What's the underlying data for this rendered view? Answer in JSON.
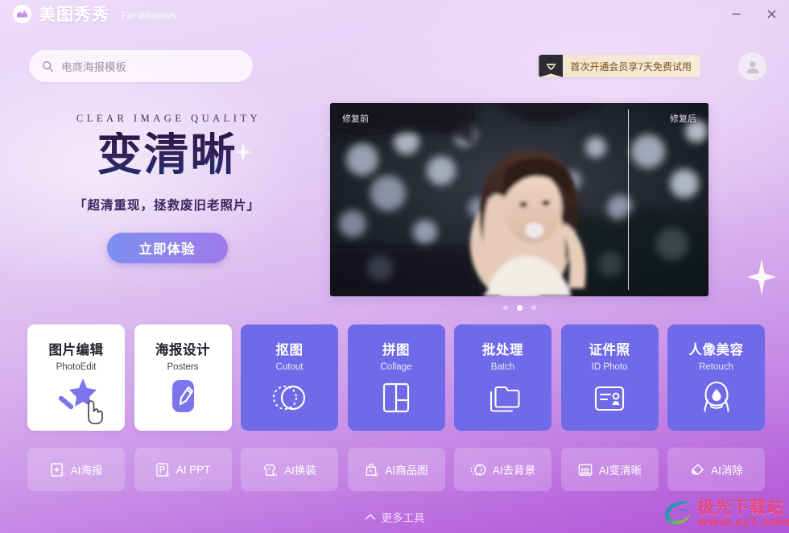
{
  "window": {
    "app_title": "美图秀秀",
    "app_subtitle": "For Windows",
    "minimize_label": "minimize",
    "close_label": "close"
  },
  "search": {
    "placeholder": "电商海报模板",
    "icon": "search-icon"
  },
  "vip": {
    "text": "首次开通会员享7天免费试用",
    "badge_icon": "vip-crown-icon",
    "badge_color": "#2e2a33",
    "banner_color": "#f3e4cc"
  },
  "account": {
    "avatar_icon": "user-avatar-icon"
  },
  "hero": {
    "eyebrow": "CLEAR IMAGE QUALITY",
    "title": "变清晰",
    "subtitle": "「超清重现，拯救废旧老照片」",
    "cta_label": "立即体验",
    "cta_color": "#8e86ee",
    "image": {
      "label_before": "修复前",
      "label_after": "修复后"
    },
    "carousel": {
      "total": 3,
      "active_index": 1
    }
  },
  "tools": [
    {
      "cn": "图片编辑",
      "en": "PhotoEdit",
      "icon": "magic-wand-icon",
      "style": "white"
    },
    {
      "cn": "海报设计",
      "en": "Posters",
      "icon": "pencil-icon",
      "style": "white"
    },
    {
      "cn": "抠图",
      "en": "Cutout",
      "icon": "cutout-circle-icon",
      "style": "purple"
    },
    {
      "cn": "拼图",
      "en": "Collage",
      "icon": "collage-grid-icon",
      "style": "purple"
    },
    {
      "cn": "批处理",
      "en": "Batch",
      "icon": "folders-icon",
      "style": "purple"
    },
    {
      "cn": "证件照",
      "en": "ID Photo",
      "icon": "id-card-icon",
      "style": "purple"
    },
    {
      "cn": "人像美容",
      "en": "Retouch",
      "icon": "portrait-face-icon",
      "style": "purple"
    }
  ],
  "ai_tools": [
    {
      "label": "AI海报",
      "icon": "ai-poster-icon"
    },
    {
      "label": "AI PPT",
      "icon": "ai-ppt-icon"
    },
    {
      "label": "AI换装",
      "icon": "ai-clothes-icon"
    },
    {
      "label": "AI商品图",
      "icon": "ai-product-bag-icon"
    },
    {
      "label": "AI去背景",
      "icon": "ai-remove-bg-icon"
    },
    {
      "label": "AI变清晰",
      "icon": "ai-hd-icon"
    },
    {
      "label": "AI消除",
      "icon": "ai-eraser-icon"
    }
  ],
  "footer": {
    "more_tools_label": "更多工具",
    "chevron_icon": "chevron-up-icon"
  },
  "watermark": {
    "site_name": "极光下载站",
    "url": "www.xz7.com",
    "color": "#e8457a"
  },
  "theme": {
    "card_purple": "#6f6ae8",
    "bg_top": "#efdcfa",
    "bg_bottom": "#b055d6"
  }
}
